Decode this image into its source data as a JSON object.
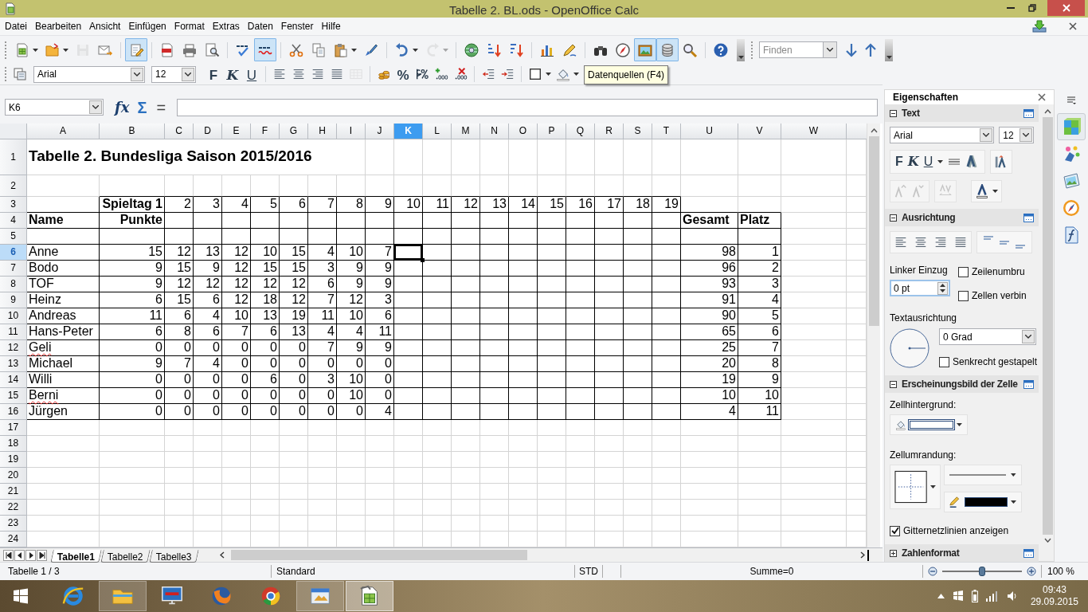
{
  "window": {
    "title": "Tabelle 2. BL.ods - OpenOffice Calc"
  },
  "menu": [
    "Datei",
    "Bearbeiten",
    "Ansicht",
    "Einfügen",
    "Format",
    "Extras",
    "Daten",
    "Fenster",
    "Hilfe"
  ],
  "toolbars": {
    "standard": [
      [
        {
          "kind": "new",
          "dropdown": true,
          "pressed": false,
          "disabled": false
        },
        {
          "kind": "open",
          "dropdown": true,
          "pressed": false,
          "disabled": false
        },
        {
          "kind": "save",
          "dropdown": false,
          "pressed": false,
          "disabled": true
        },
        {
          "kind": "mail",
          "dropdown": false,
          "pressed": false,
          "disabled": false
        }
      ],
      [
        {
          "kind": "edit",
          "dropdown": false,
          "pressed": true,
          "disabled": false
        }
      ],
      [
        {
          "kind": "pdf",
          "dropdown": false,
          "pressed": false,
          "disabled": false
        },
        {
          "kind": "print",
          "dropdown": false,
          "pressed": false,
          "disabled": false
        },
        {
          "kind": "preview",
          "dropdown": false,
          "pressed": false,
          "disabled": false
        }
      ],
      [
        {
          "kind": "spell",
          "dropdown": false,
          "pressed": false,
          "disabled": false
        },
        {
          "kind": "autospell",
          "dropdown": false,
          "pressed": true,
          "disabled": false
        }
      ],
      [
        {
          "kind": "cut",
          "dropdown": false,
          "pressed": false,
          "disabled": false
        },
        {
          "kind": "copy",
          "dropdown": false,
          "pressed": false,
          "disabled": false
        },
        {
          "kind": "paste",
          "dropdown": true,
          "pressed": false,
          "disabled": false
        },
        {
          "kind": "brush",
          "dropdown": false,
          "pressed": false,
          "disabled": false
        }
      ],
      [
        {
          "kind": "undo",
          "dropdown": true,
          "pressed": false,
          "disabled": false
        },
        {
          "kind": "redo",
          "dropdown": true,
          "pressed": false,
          "disabled": true
        }
      ],
      [
        {
          "kind": "hyperlink",
          "dropdown": false,
          "pressed": false,
          "disabled": false
        },
        {
          "kind": "sortaz",
          "dropdown": false,
          "pressed": false,
          "disabled": false
        },
        {
          "kind": "sortza",
          "dropdown": false,
          "pressed": false,
          "disabled": false
        }
      ],
      [
        {
          "kind": "chart",
          "dropdown": false,
          "pressed": false,
          "disabled": false
        },
        {
          "kind": "draw",
          "dropdown": false,
          "pressed": false,
          "disabled": false
        }
      ],
      [
        {
          "kind": "find",
          "dropdown": false,
          "pressed": false,
          "disabled": false
        },
        {
          "kind": "navigator",
          "dropdown": false,
          "pressed": false,
          "disabled": false
        },
        {
          "kind": "gallery",
          "dropdown": false,
          "pressed": true,
          "disabled": false
        },
        {
          "kind": "datasource",
          "dropdown": false,
          "pressed": true,
          "disabled": false
        },
        {
          "kind": "zoom",
          "dropdown": false,
          "pressed": false,
          "disabled": false
        }
      ],
      [
        {
          "kind": "help",
          "dropdown": false,
          "pressed": false,
          "disabled": false
        }
      ]
    ],
    "find": {
      "placeholder": "Finden"
    },
    "formatting": {
      "font": "Arial",
      "size": "12",
      "groups": [
        [
          {
            "kind": "bold",
            "label": "F"
          },
          {
            "kind": "italic",
            "label": "K"
          },
          {
            "kind": "underline",
            "label": "U"
          }
        ],
        [
          {
            "kind": "alignleft",
            "disabled": false
          },
          {
            "kind": "aligncenter",
            "disabled": false
          },
          {
            "kind": "alignright",
            "disabled": false
          },
          {
            "kind": "justify",
            "disabled": false
          },
          {
            "kind": "merge",
            "disabled": true
          }
        ],
        [
          {
            "kind": "currency",
            "disabled": false
          },
          {
            "kind": "text",
            "label": "%"
          },
          {
            "kind": "numberformat",
            "disabled": false
          },
          {
            "kind": "adddecimal",
            "disabled": false
          },
          {
            "kind": "deldecimal",
            "disabled": false
          }
        ],
        [
          {
            "kind": "outdent",
            "disabled": false
          },
          {
            "kind": "indent",
            "disabled": false
          }
        ],
        [
          {
            "kind": "border",
            "disabled": false
          },
          {
            "kind": "bgcolor",
            "disabled": false
          }
        ]
      ]
    }
  },
  "tooltip": "Datenquellen (F4)",
  "formula_bar": {
    "name_box": "K6",
    "function_wizard": "fx",
    "sum": "Σ",
    "equals": "="
  },
  "sheet": {
    "columns": [
      {
        "label": "A",
        "selected": false
      },
      {
        "label": "B",
        "selected": false
      },
      {
        "label": "C",
        "selected": false
      },
      {
        "label": "D",
        "selected": false
      },
      {
        "label": "E",
        "selected": false
      },
      {
        "label": "F",
        "selected": false
      },
      {
        "label": "G",
        "selected": false
      },
      {
        "label": "H",
        "selected": false
      },
      {
        "label": "I",
        "selected": false
      },
      {
        "label": "J",
        "selected": false
      },
      {
        "label": "K",
        "selected": true
      },
      {
        "label": "L",
        "selected": false
      },
      {
        "label": "M",
        "selected": false
      },
      {
        "label": "N",
        "selected": false
      },
      {
        "label": "O",
        "selected": false
      },
      {
        "label": "P",
        "selected": false
      },
      {
        "label": "Q",
        "selected": false
      },
      {
        "label": "R",
        "selected": false
      },
      {
        "label": "S",
        "selected": false
      },
      {
        "label": "T",
        "selected": false
      },
      {
        "label": "U",
        "selected": false
      },
      {
        "label": "V",
        "selected": false
      },
      {
        "label": "W",
        "selected": false
      }
    ],
    "rows": [
      {
        "label": "1",
        "selected": false
      },
      {
        "label": "2",
        "selected": false
      },
      {
        "label": "3",
        "selected": false
      },
      {
        "label": "4",
        "selected": false
      },
      {
        "label": "5",
        "selected": false
      },
      {
        "label": "6",
        "selected": true
      },
      {
        "label": "7",
        "selected": false
      },
      {
        "label": "8",
        "selected": false
      },
      {
        "label": "9",
        "selected": false
      },
      {
        "label": "10",
        "selected": false
      },
      {
        "label": "11",
        "selected": false
      },
      {
        "label": "12",
        "selected": false
      },
      {
        "label": "13",
        "selected": false
      },
      {
        "label": "14",
        "selected": false
      },
      {
        "label": "15",
        "selected": false
      },
      {
        "label": "16",
        "selected": false
      },
      {
        "label": "17",
        "selected": false
      },
      {
        "label": "18",
        "selected": false
      },
      {
        "label": "19",
        "selected": false
      },
      {
        "label": "20",
        "selected": false
      },
      {
        "label": "21",
        "selected": false
      },
      {
        "label": "22",
        "selected": false
      },
      {
        "label": "23",
        "selected": false
      },
      {
        "label": "24",
        "selected": false
      }
    ],
    "title": "Tabelle 2. Bundesliga Saison 2015/2016",
    "matchdays": [
      "Spieltag 1",
      "2",
      "3",
      "4",
      "5",
      "6",
      "7",
      "8",
      "9",
      "10",
      "11",
      "12",
      "13",
      "14",
      "15",
      "16",
      "17",
      "18",
      "19"
    ],
    "name_header": "Name",
    "points_header": "Punkte",
    "total_header": "Gesamt",
    "rank_header": "Platz",
    "players": [
      {
        "name": "Anne",
        "misspelled": false,
        "points": [
          "15",
          "12",
          "13",
          "12",
          "10",
          "15",
          "4",
          "10",
          "7"
        ],
        "total": "98",
        "rank": "1"
      },
      {
        "name": "Bodo",
        "misspelled": false,
        "points": [
          "9",
          "15",
          "9",
          "12",
          "15",
          "15",
          "3",
          "9",
          "9"
        ],
        "total": "96",
        "rank": "2"
      },
      {
        "name": "TOF",
        "misspelled": false,
        "points": [
          "9",
          "12",
          "12",
          "12",
          "12",
          "12",
          "6",
          "9",
          "9"
        ],
        "total": "93",
        "rank": "3"
      },
      {
        "name": "Heinz",
        "misspelled": false,
        "points": [
          "6",
          "15",
          "6",
          "12",
          "18",
          "12",
          "7",
          "12",
          "3"
        ],
        "total": "91",
        "rank": "4"
      },
      {
        "name": "Andreas",
        "misspelled": false,
        "points": [
          "11",
          "6",
          "4",
          "10",
          "13",
          "19",
          "11",
          "10",
          "6"
        ],
        "total": "90",
        "rank": "5"
      },
      {
        "name": "Hans-Peter",
        "misspelled": false,
        "points": [
          "6",
          "8",
          "6",
          "7",
          "6",
          "13",
          "4",
          "4",
          "11"
        ],
        "total": "65",
        "rank": "6"
      },
      {
        "name": "Geli",
        "misspelled": true,
        "points": [
          "0",
          "0",
          "0",
          "0",
          "0",
          "0",
          "7",
          "9",
          "9"
        ],
        "total": "25",
        "rank": "7"
      },
      {
        "name": "Michael",
        "misspelled": false,
        "points": [
          "9",
          "7",
          "4",
          "0",
          "0",
          "0",
          "0",
          "0",
          "0"
        ],
        "total": "20",
        "rank": "8"
      },
      {
        "name": "Willi",
        "misspelled": false,
        "points": [
          "0",
          "0",
          "0",
          "0",
          "6",
          "0",
          "3",
          "10",
          "0"
        ],
        "total": "19",
        "rank": "9"
      },
      {
        "name": "Berni",
        "misspelled": true,
        "points": [
          "0",
          "0",
          "0",
          "0",
          "0",
          "0",
          "0",
          "10",
          "0"
        ],
        "total": "10",
        "rank": "10"
      },
      {
        "name": "Jürgen",
        "misspelled": false,
        "points": [
          "0",
          "0",
          "0",
          "0",
          "0",
          "0",
          "0",
          "0",
          "4"
        ],
        "total": "4",
        "rank": "11"
      }
    ],
    "tabs": [
      {
        "label": "Tabelle1",
        "selected": true
      },
      {
        "label": "Tabelle2",
        "selected": false
      },
      {
        "label": "Tabelle3",
        "selected": false
      }
    ]
  },
  "sidebar": {
    "title": "Eigenschaften",
    "sections": [
      {
        "kind": "text",
        "title": "Text",
        "expanded": true,
        "font": "Arial",
        "size": "12",
        "buttons": [
          {
            "kind": "bold",
            "label": "F"
          },
          {
            "kind": "italic",
            "label": "K"
          },
          {
            "kind": "underline",
            "label": "U"
          }
        ]
      },
      {
        "kind": "alignment",
        "title": "Ausrichtung",
        "expanded": true,
        "indent_label": "Linker Einzug",
        "indent_value": "0 pt",
        "options": [
          {
            "label": "Zeilenumbru",
            "checked": false
          },
          {
            "label": "Zellen verbin",
            "checked": false
          }
        ],
        "orientation_label": "Textausrichtung",
        "angle": "0 Grad",
        "stacked": {
          "label": "Senkrecht gestapelt",
          "checked": false
        }
      },
      {
        "kind": "cell_appearance",
        "title": "Erscheinungsbild der Zelle",
        "expanded": true,
        "background_label": "Zellhintergrund:",
        "border_label": "Zellumrandung:",
        "gridlines": {
          "label": "Gitternetzlinien anzeigen",
          "checked": true
        }
      },
      {
        "kind": "number_format",
        "title": "Zahlenformat",
        "expanded": false
      }
    ],
    "tabs": [
      {
        "kind": "properties",
        "selected": true
      },
      {
        "kind": "styles",
        "selected": false
      },
      {
        "kind": "gallery",
        "selected": false
      },
      {
        "kind": "navigator",
        "selected": false
      },
      {
        "kind": "functions",
        "selected": false
      }
    ]
  },
  "status_bar": {
    "sheet": "Tabelle 1 / 3",
    "style": "Standard",
    "mode": "STD",
    "sum": "Summe=0",
    "zoom_slider": {
      "level": 0.5
    },
    "zoom": "100 %"
  },
  "taskbar": {
    "apps": [
      {
        "kind": "ie",
        "running": false,
        "active": false
      },
      {
        "kind": "explorer",
        "running": true,
        "active": false
      },
      {
        "kind": "monitor",
        "running": false,
        "active": false
      },
      {
        "kind": "firefox",
        "running": false,
        "active": false
      },
      {
        "kind": "chrome",
        "running": false,
        "active": false
      },
      {
        "kind": "mailapp",
        "running": true,
        "active": false
      },
      {
        "kind": "calc",
        "running": true,
        "active": true
      }
    ],
    "time": "09:43",
    "date": "29.09.2015"
  }
}
